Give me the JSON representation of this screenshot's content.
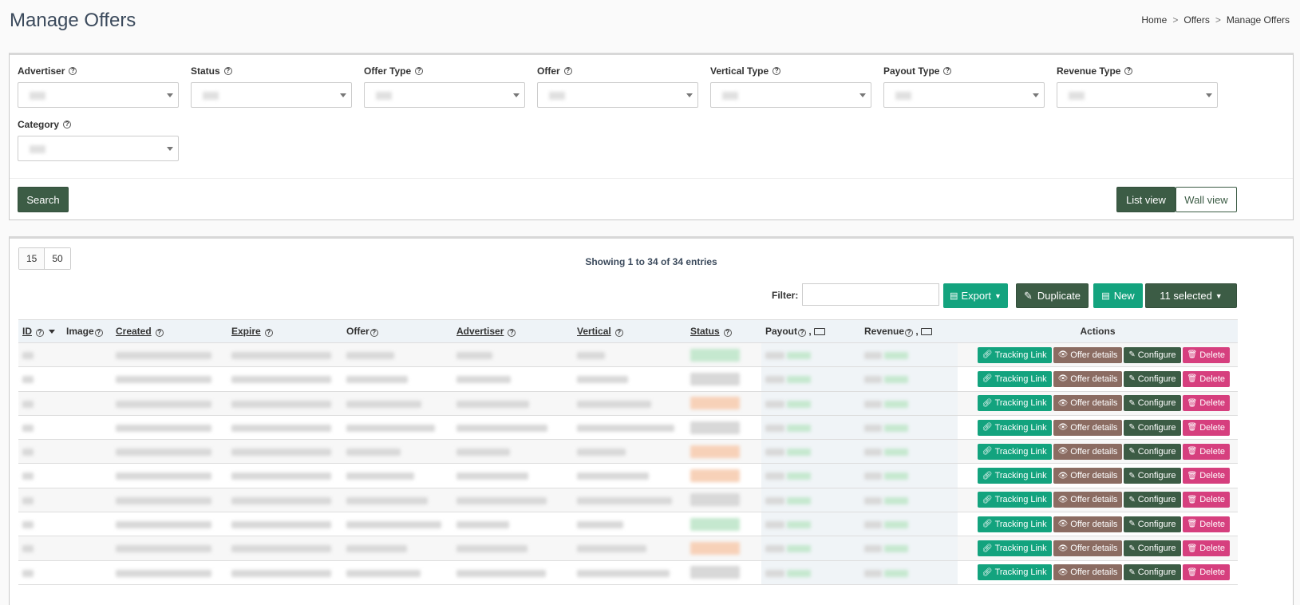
{
  "header": {
    "title": "Manage Offers",
    "breadcrumb": [
      "Home",
      "Offers",
      "Manage Offers"
    ]
  },
  "filters": [
    {
      "label": "Advertiser"
    },
    {
      "label": "Status"
    },
    {
      "label": "Offer Type"
    },
    {
      "label": "Offer"
    },
    {
      "label": "Vertical Type"
    },
    {
      "label": "Payout Type"
    },
    {
      "label": "Revenue Type"
    },
    {
      "label": "Category"
    }
  ],
  "search_label": "Search",
  "views": {
    "list": "List view",
    "wall": "Wall view"
  },
  "pager": [
    "15",
    "50"
  ],
  "showing": "Showing 1 to 34 of 34 entries",
  "filter_label": "Filter:",
  "toolbar": {
    "export": "Export",
    "duplicate": "Duplicate",
    "new": "New",
    "selected": "11 selected"
  },
  "columns": {
    "id": "ID",
    "image": "Image",
    "created": "Created",
    "expire": "Expire",
    "offer": "Offer",
    "advertiser": "Advertiser",
    "vertical": "Vertical",
    "status": "Status",
    "payout": "Payout",
    "revenue": "Revenue",
    "actions": "Actions"
  },
  "actions": {
    "tracking": "Tracking Link",
    "details": "Offer details",
    "configure": "Configure",
    "delete": "Delete"
  },
  "rows": [
    {
      "status_color": "green"
    },
    {
      "status_color": "gray"
    },
    {
      "status_color": "orange"
    },
    {
      "status_color": "gray"
    },
    {
      "status_color": "orange"
    },
    {
      "status_color": "orange"
    },
    {
      "status_color": "gray"
    },
    {
      "status_color": "green"
    },
    {
      "status_color": "orange"
    },
    {
      "status_color": "gray"
    }
  ]
}
